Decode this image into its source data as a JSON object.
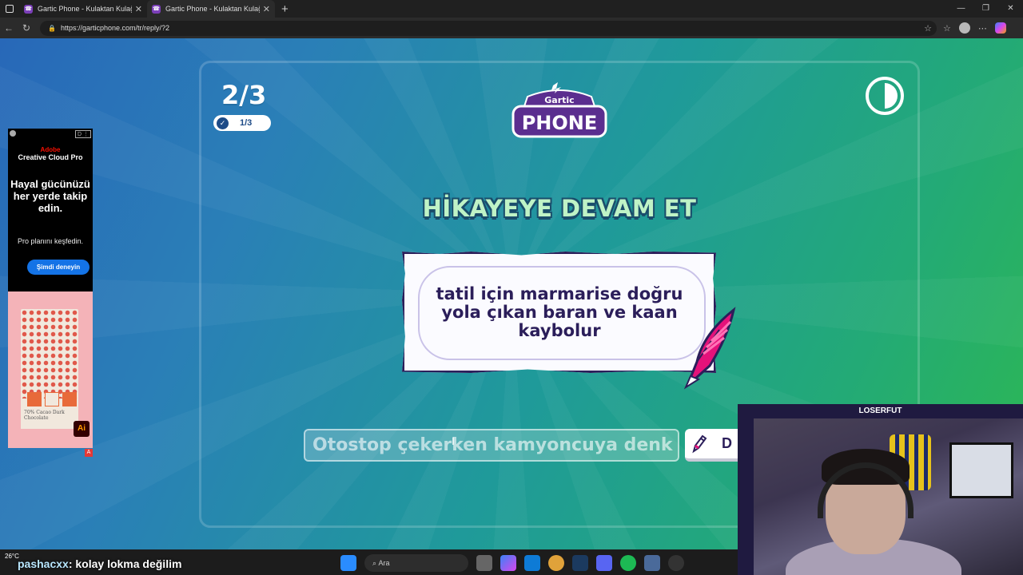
{
  "browser": {
    "tabs": [
      {
        "title": "Gartic Phone - Kulaktan Kulağa"
      },
      {
        "title": "Gartic Phone - Kulaktan Kulağa"
      }
    ],
    "url": "https://garticphone.com/tr/reply/?2"
  },
  "game": {
    "round": "2/3",
    "done_count": "1/3",
    "logo_top": "Gartic",
    "logo_bottom": "PHONE",
    "heading": "HİKAYEYE DEVAM ET",
    "prompt": "tatil için marmarise doğru yola çıkan baran ve kaan kaybolur",
    "answer_value": "Otostop çekerken kamyoncuya denk gelirle",
    "done_button": "D"
  },
  "ad": {
    "brand_line1": "Adobe",
    "brand_line2": "Creative Cloud Pro",
    "headline": "Hayal gücünüzü her yerde takip edin.",
    "subtext": "Pro planını keşfedin.",
    "cta": "Şimdi deneyin",
    "product_label": "70% Cacao Dark Chocolate",
    "ai_badge": "Ai"
  },
  "stream": {
    "cam_name": "LOSERFUT",
    "chat_user": "pashacxx",
    "chat_text": ": kolay lokma değilim"
  },
  "taskbar": {
    "weather": "26°C",
    "search_placeholder": "Ara"
  },
  "colors": {
    "accent_navy": "#2b1e5a",
    "heading_green": "#bff3c6"
  }
}
